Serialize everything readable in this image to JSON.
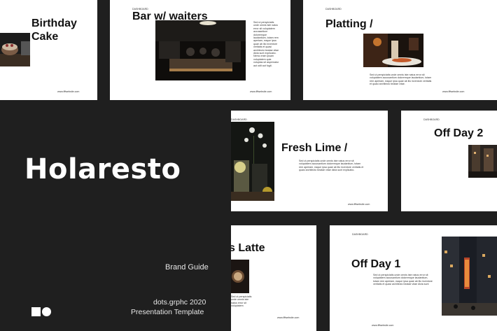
{
  "brand": {
    "name": "Holaresto",
    "subtitle": "Brand Guide",
    "credit": "dots.grphc 2020",
    "template_type": "Presentation Template",
    "logo_icon": "square-circle-logo-icon",
    "background": "#1f1f1f",
    "text_color": "#ffffff"
  },
  "slides": {
    "birthday": {
      "title_line1": "Birthday",
      "title_line2": "Cake",
      "url": "www.fffwebsite.com"
    },
    "bar": {
      "label": "DASHBOARD",
      "title": "Bar w/ waiters",
      "url": "www.fffwebsite.com",
      "body": "Sed ut perspiciatis unde omnis iste natus error sit voluptatem accusantium doloremque laudantium, totam rem aperiam, eaque ipsa quae ab illo inventore veritatis et quasi architecto beatae vitae dicta sunt explicabo. Nemo enim ipsam voluptatem quia voluptas sit aspernatur aut odit aut fugit."
    },
    "platting": {
      "label": "DASHBOARD",
      "title": "Platting /",
      "url": "www.fffwebsite.com",
      "body": "Sed ut perspiciatis unde omnis iste natus error sit voluptatem accusantium doloremque laudantium, totam rem aperiam, eaque ipsa quae ab illo inventore veritatis et quasi architecto beatae vitae."
    },
    "fresh_lime": {
      "label": "DASHBOARD",
      "title": "Fresh Lime /",
      "url": "www.fffwebsite.com",
      "body": "Sed ut perspiciatis unde omnis iste natus error sit voluptatem accusantium doloremque laudantium, totam rem aperiam, eaque ipsa quae ab illo inventore veritatis et quasi architecto beatae vitae dicta sunt explicabo."
    },
    "off_day_2": {
      "label": "DASHBOARD",
      "title": "Off Day 2"
    },
    "latte": {
      "title": "s Latte",
      "url": "www.fffwebsite.com",
      "body": "Sed ut perspiciatis unde omnis iste natus error sit voluptatem accusantium doloremque laudantium, totam rem aperiam, eaque ipsa quae ab illo inventore veritatis et quasi architecto beatae vitae dicta sunt explicabo."
    },
    "off_day_1": {
      "label": "DASHBOARD",
      "title": "Off Day 1",
      "url": "www.fffwebsite.com",
      "body": "Sed ut perspiciatis unde omnis iste natus error sit voluptatem accusantium doloremque laudantium, totam rem aperiam, eaque ipsa quae ab illo inventore veritatis et quasi architecto beatae vitae dicta sunt explicabo."
    }
  }
}
